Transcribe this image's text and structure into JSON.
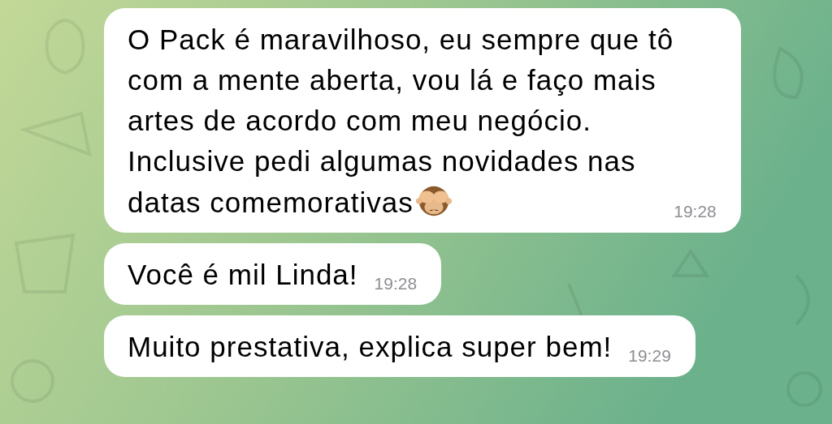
{
  "messages": [
    {
      "text": "O Pack é maravilhoso, eu sempre que tô\ncom a mente aberta, vou lá e faço mais\nartes de acordo com meu negócio.\nInclusive pedi algumas novidades nas\ndatas comemorativas",
      "emoji": true,
      "time": "19:28"
    },
    {
      "text": "Você é mil Linda!",
      "emoji": false,
      "time": "19:28"
    },
    {
      "text": "Muito prestativa, explica super bem!",
      "emoji": false,
      "time": "19:29"
    }
  ]
}
